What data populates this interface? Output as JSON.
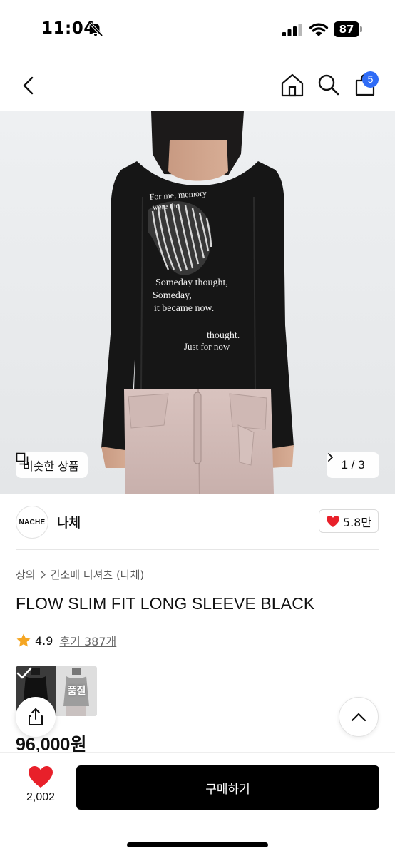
{
  "status_bar": {
    "time": "11:04",
    "battery": "87",
    "icons": [
      "mute-icon",
      "signal-icon",
      "wifi-icon",
      "battery-icon"
    ]
  },
  "top_nav": {
    "icons": [
      "back-icon",
      "home-icon",
      "search-icon",
      "shopping-bag-icon"
    ],
    "cart_count": "5",
    "badge_color": "#2f6cf6"
  },
  "gallery": {
    "similar_label": "비슷한 상품",
    "page": "1 / 3",
    "print_text": [
      "For me, memory",
      "were the",
      "Someday thought,",
      "Someday,",
      "it became now.",
      "thought.",
      "Just for now"
    ]
  },
  "brand": {
    "logo_text": "NACHE",
    "name": "나체",
    "likes": "5.8만"
  },
  "breadcrumb": [
    "상의",
    "긴소매 티셔츠 (나체)"
  ],
  "product": {
    "title": "FLOW SLIM FIT LONG SLEEVE BLACK",
    "rating": "4.9",
    "reviews": "후기 387개",
    "soldout_label": "품절",
    "price": "96,000원"
  },
  "bottom_bar": {
    "wish_count": "2,002",
    "buy_label": "구매하기"
  },
  "colors": {
    "heart": "#e8202a",
    "star": "#f5a623",
    "buy_button": "#000000"
  }
}
